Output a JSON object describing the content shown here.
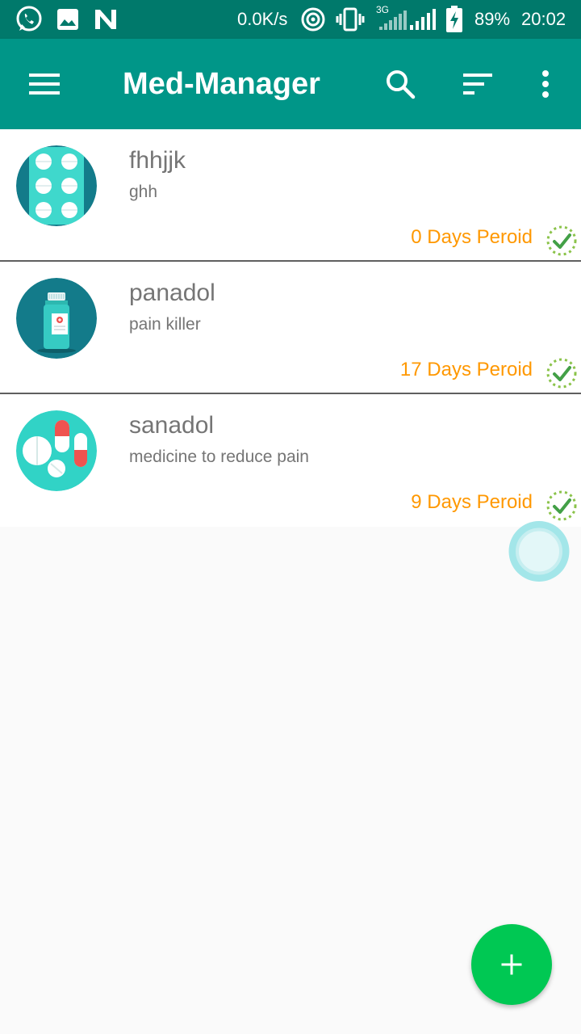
{
  "status_bar": {
    "net_speed": "0.0K/s",
    "network_type": "3G",
    "battery": "89%",
    "time": "20:02",
    "icons": [
      "whatsapp-icon",
      "gallery-icon",
      "n-icon",
      "hotspot-icon",
      "vibrate-icon",
      "signal-icon",
      "signal-icon-2",
      "battery-charging-icon"
    ]
  },
  "app_bar": {
    "title": "Med-Manager",
    "icons": [
      "menu-icon",
      "search-icon",
      "sort-icon",
      "more-vert-icon"
    ]
  },
  "medicines": [
    {
      "name": "fhhjjk",
      "description": "ghh",
      "period": "0 Days Peroid",
      "avatar": "pill-blister-icon"
    },
    {
      "name": "panadol",
      "description": "pain killer",
      "period": "17 Days Peroid",
      "avatar": "medicine-bottle-icon"
    },
    {
      "name": "sanadol",
      "description": "medicine to reduce pain",
      "period": "9 Days Peroid",
      "avatar": "capsules-icon"
    }
  ],
  "fab": {
    "icon": "plus-icon"
  },
  "colors": {
    "status_bar": "#00796b",
    "app_bar": "#009688",
    "period_text": "#ff9800",
    "fab": "#00c853",
    "check": "#7cb342"
  }
}
